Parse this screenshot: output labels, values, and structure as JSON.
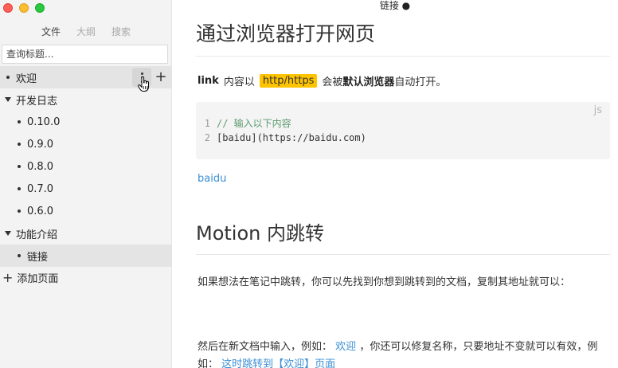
{
  "window": {
    "title": "链接 ●"
  },
  "sidebar": {
    "tabs": [
      {
        "label": "文件",
        "active": true
      },
      {
        "label": "大纲",
        "active": false
      },
      {
        "label": "搜索",
        "active": false
      }
    ],
    "search_placeholder": "查询标题...",
    "tree": [
      {
        "label": "欢迎",
        "kind": "page",
        "level": 0
      },
      {
        "label": "开发日志",
        "kind": "folder",
        "level": 0
      },
      {
        "label": "0.10.0",
        "kind": "page",
        "level": 1
      },
      {
        "label": "0.9.0",
        "kind": "page",
        "level": 1
      },
      {
        "label": "0.8.0",
        "kind": "page",
        "level": 1
      },
      {
        "label": "0.7.0",
        "kind": "page",
        "level": 1
      },
      {
        "label": "0.6.0",
        "kind": "page",
        "level": 1
      },
      {
        "label": "功能介绍",
        "kind": "folder",
        "level": 0
      },
      {
        "label": "链接",
        "kind": "page",
        "level": 1
      }
    ],
    "add_page_label": "添加页面"
  },
  "doc": {
    "h1": "通过浏览器打开网页",
    "para1": {
      "bold1": "link",
      "text1": "内容以",
      "tag": "http/https",
      "text2": "会被",
      "bold2": "默认浏览器",
      "text3": "自动打开。"
    },
    "code": {
      "lang": "js",
      "lines": [
        {
          "num": "1",
          "comment": "//  输入以下内容",
          "text": ""
        },
        {
          "num": "2",
          "comment": "",
          "text": "[baidu](https://baidu.com)"
        }
      ]
    },
    "link_text": "baidu",
    "h2": "Motion 内跳转",
    "para2": "如果想法在笔记中跳转，你可以先找到你想到跳转到的文档，复制其地址就可以：",
    "para3": {
      "text1": "然后在新文档中输入，例如：",
      "link1": "欢迎",
      "text2": "，你还可以修复名称，只要地址不变就可以有效，例如：",
      "link2": "这时跳转到【欢迎】页面"
    }
  },
  "colors": {
    "accent_link": "#3a8fd6",
    "tag_bg": "#ffc400",
    "sidebar_bg": "#f3f3f3"
  }
}
